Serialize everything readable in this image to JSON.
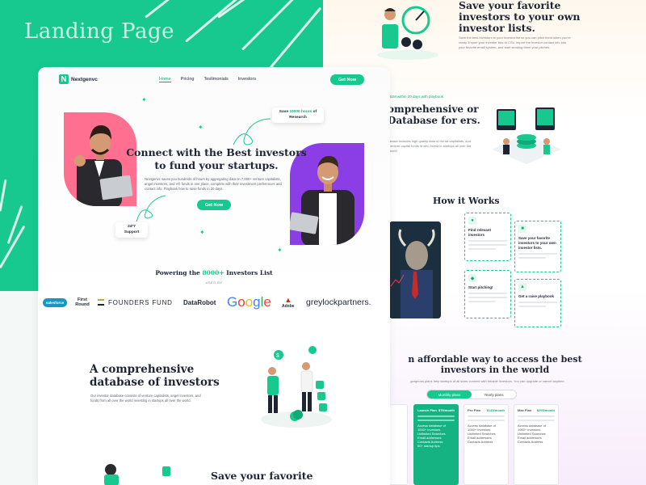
{
  "showcase": {
    "title": "Landing Page"
  },
  "nav": {
    "brand": "Nextgenvc",
    "links": [
      "Home",
      "Pricing",
      "Testimonials",
      "Investors"
    ],
    "cta": "Get Now"
  },
  "hero": {
    "title": "Connect with the Best investors to fund your startups.",
    "subtitle": "Nextgenvc saves you hundreds of hours by aggregating data on 7,000+ venture capitalists, angel investors, and VC funds in one place, complete with their investment preferences and contact info. Playbook how to raise funds in 20 days.",
    "cta": "Get Now",
    "badge_research_pre": "Save",
    "badge_research_hl": "10000 hours",
    "badge_research_post": "of Research",
    "badge_support_top": "24*7",
    "badge_support_bottom": "Support"
  },
  "powering": {
    "pre": "Powering the",
    "hl": "8000+",
    "post": "Investors List",
    "used_by": "USED BY"
  },
  "logos": [
    "salesforce",
    "First Round",
    "FOUNDERS FUND",
    "DataRobot",
    "Google",
    "Adobe",
    "greylockpartners."
  ],
  "section2": {
    "title": "A comprehensive database of investors",
    "body": "Our investor database consists of venture capitalists, angel investors, and funds from all over the world investing in startups all over the world."
  },
  "section3": {
    "title": "Save your favorite"
  },
  "preview": {
    "save_title": "Save your favorite investors to your own investor lists.",
    "save_body": "Save the best investors to your investor list so you can pitch them when you're ready. Export your investor lists to CSV, import the investor contact info into your favorite email system, and start sending them your pitches.",
    "db_pre": "$1M within 20 days with playbook.",
    "db_title": "omprehensive or Database for ers.",
    "db_body": "abase includes high quality data of the tal capitalists, and venture capital funds ld who invest in startups all over the world.",
    "how_title": "How it Works",
    "steps": [
      "Find relevant investors",
      "Save your favorite investors to your own investor lists.",
      "Start pitching!",
      "Get a raise playbook"
    ],
    "afford_title": "n affordable way to access the best investors in the world",
    "afford_sub": "gorgeous plans help startups of all sizes connect with reliable investors. You can upgrade or cancel anytime.",
    "toggle": [
      "Monthly plans",
      "Yearly plans"
    ],
    "plans": [
      {
        "name": "Launch Plan",
        "price": "$79/month"
      },
      {
        "name": "Pro Plan",
        "price": "$149/month"
      },
      {
        "name": "Max Plan",
        "price": "$299/month"
      }
    ],
    "plan_features": [
      "Access database of 1000+ investors",
      "Unlimited Searches",
      "Email addresses",
      "Contacts Address",
      "50+ startup tips"
    ]
  },
  "colors": {
    "accent": "#17c98f",
    "dark": "#1d2433",
    "pink": "#ff6f8f",
    "purple": "#8b3ee6"
  }
}
